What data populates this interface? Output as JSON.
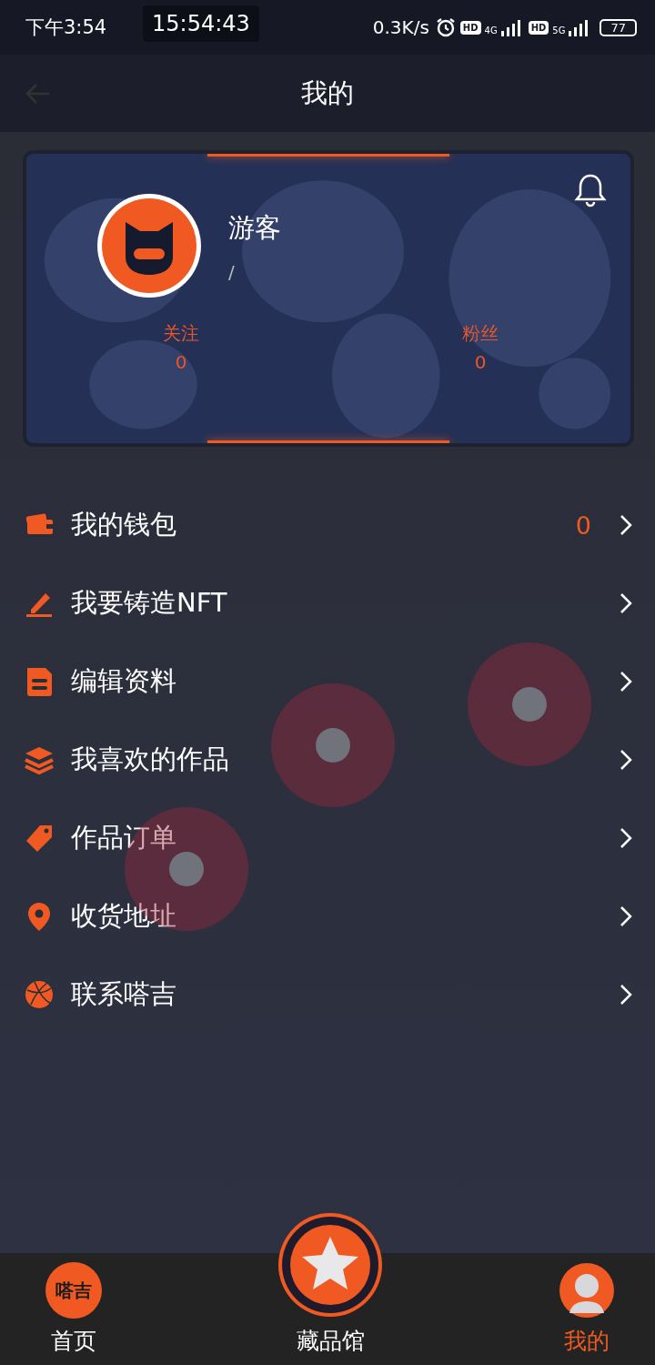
{
  "status_bar": {
    "time": "下午3:54",
    "clock": "15:54:43",
    "speed": "0.3K/s",
    "sim1_badge": "HD",
    "sim1_network": "4G",
    "sim2_badge": "HD",
    "sim2_network": "5G",
    "battery": "77"
  },
  "header": {
    "title": "我的"
  },
  "profile": {
    "name": "游客",
    "subtitle": "/",
    "stats": [
      {
        "label": "关注",
        "value": "0"
      },
      {
        "label": "粉丝",
        "value": "0"
      }
    ]
  },
  "menu": [
    {
      "kind": "wallet",
      "label": "我的钱包",
      "value": "0"
    },
    {
      "kind": "pen",
      "label": "我要铸造NFT"
    },
    {
      "kind": "document",
      "label": "编辑资料"
    },
    {
      "kind": "layers",
      "label": "我喜欢的作品"
    },
    {
      "kind": "tag",
      "label": "作品订单"
    },
    {
      "kind": "pin",
      "label": "收货地址"
    },
    {
      "kind": "globe",
      "label": "联系嗒吉"
    }
  ],
  "tab_bar": {
    "home_logo": "嗒吉",
    "tabs": [
      {
        "kind": "home",
        "label": "首页",
        "selected": false
      },
      {
        "kind": "collection",
        "label": "藏品馆",
        "selected": false
      },
      {
        "kind": "mine",
        "label": "我的",
        "selected": true
      }
    ]
  }
}
